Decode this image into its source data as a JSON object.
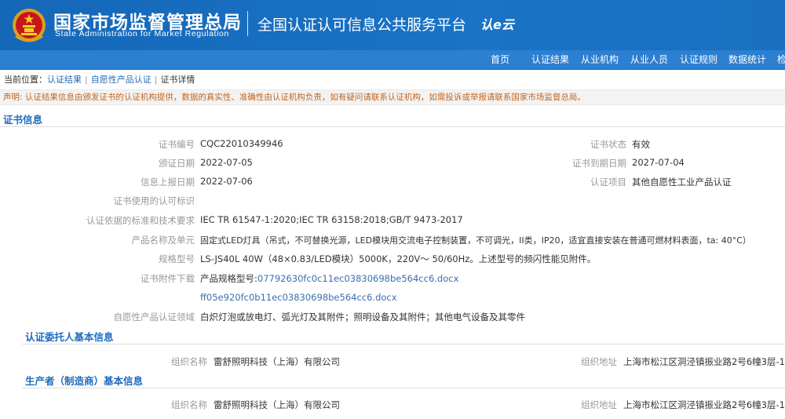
{
  "header": {
    "agency_cn": "国家市场监督管理总局",
    "agency_en": "State Administration  for  Market Regulation",
    "platform_title": "全国认证认可信息公共服务平台",
    "logo_text": "认e云"
  },
  "nav": {
    "items": [
      "首页",
      "认证结果",
      "从业机构",
      "从业人员",
      "认证规则",
      "数据统计",
      "检"
    ]
  },
  "breadcrumb": {
    "prefix": "当前位置：",
    "items": [
      "认证结果",
      "自愿性产品认证",
      "证书详情"
    ],
    "separator": "|"
  },
  "notice": "声明: 认证结果信息由颁发证书的认证机构提供，数据的真实性、准确性由认证机构负责，如有疑问请联系认证机构，如需投诉或举报请联系国家市场监督总局。",
  "cert_info": {
    "title": "证书信息",
    "labels": {
      "cert_no": "证书编号",
      "issue_date": "颁证日期",
      "report_date": "信息上报日期",
      "mark": "证书使用的认可标识",
      "standards": "认证依据的标准和技术要求",
      "product": "产品名称及单元",
      "model": "规格型号",
      "attachment": "证书附件下载",
      "field": "自愿性产品认证领域",
      "status": "证书状态",
      "expiry": "证书到期日期",
      "project": "认证项目"
    },
    "values": {
      "cert_no": "CQC22010349946",
      "issue_date": "2022-07-05",
      "report_date": "2022-07-06",
      "standards": "IEC TR 61547-1:2020;IEC TR 63158:2018;GB/T 9473-2017",
      "product": "固定式LED灯具（吊式，不可替换光源，LED模块用交流电子控制装置，不可调光，II类，IP20，适宜直接安装在普通可燃材料表面，ta: 40°C）",
      "model": "LS-JS40L 40W（48×0.83/LED模块）5000K，220V～ 50/60Hz。上述型号的频闪性能见附件。",
      "attachment_prefix": "产品规格型号:",
      "attachment_file_1": "07792630fc0c11ec03830698be564cc6.docx",
      "attachment_file_2": "ff05e920fc0b11ec03830698be564cc6.docx",
      "field": "白炽灯泡或放电灯、弧光灯及其附件；照明设备及其附件；其他电气设备及其零件",
      "status": "有效",
      "expiry": "2027-07-04",
      "project": "其他自愿性工业产品认证"
    }
  },
  "client_info": {
    "title": "认证委托人基本信息",
    "org_label": "组织名称",
    "org_value": "雷舒照明科技（上海）有限公司",
    "addr_label": "组织地址",
    "addr_value": "上海市松江区洞泾镇振业路2号6幢3层-1"
  },
  "producer_info": {
    "title": "生产者（制造商）基本信息",
    "org_label": "组织名称",
    "org_value": "雷舒照明科技（上海）有限公司",
    "addr_label": "组织地址",
    "addr_value": "上海市松江区洞泾镇振业路2号6幢3层-1"
  },
  "colors": {
    "header_blue": "#1a6fc0",
    "nav_blue": "#2c7fd1",
    "section_title": "#1e6cc0",
    "notice_text": "#c3661f",
    "link": "#3a6fb0"
  }
}
